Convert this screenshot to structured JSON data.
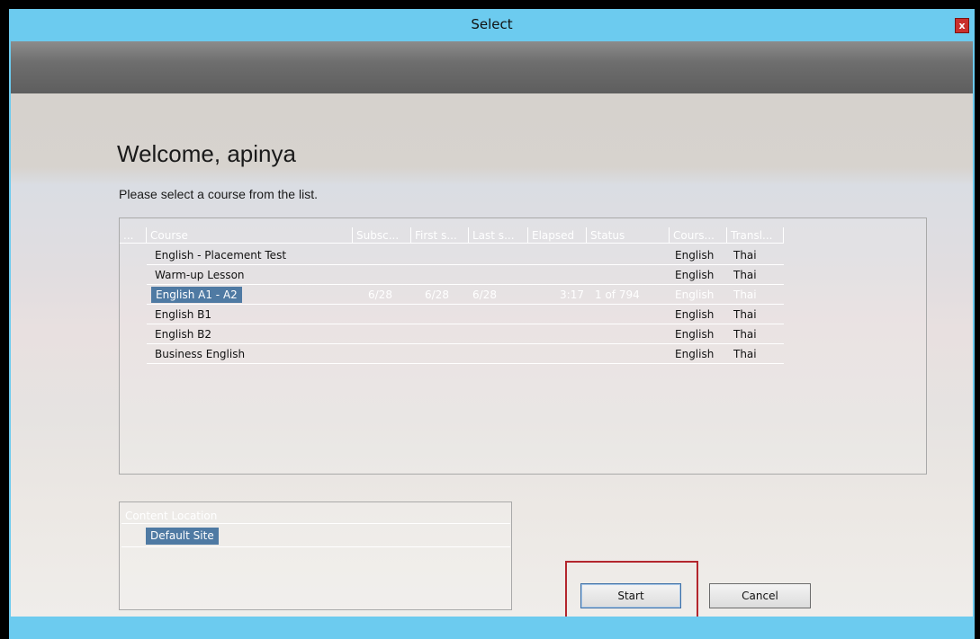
{
  "window": {
    "title": "Select",
    "close_label": "x"
  },
  "welcome_text": "Welcome, apinya",
  "instruction_text": "Please select a course from the list.",
  "course_table": {
    "columns": [
      "...",
      "Course",
      "Subsc...",
      "First s...",
      "Last s...",
      "Elapsed",
      "Status",
      "Cours...",
      "Transl..."
    ],
    "rows": [
      {
        "course": "English - Placement Test",
        "subsc": "",
        "first": "",
        "last": "",
        "elapsed": "",
        "status": "",
        "course_lang": "English",
        "transl": "Thai",
        "selected": false
      },
      {
        "course": "Warm-up Lesson",
        "subsc": "",
        "first": "",
        "last": "",
        "elapsed": "",
        "status": "",
        "course_lang": "English",
        "transl": "Thai",
        "selected": false
      },
      {
        "course": "English A1 - A2",
        "subsc": "6/28",
        "first": "6/28",
        "last": "6/28",
        "elapsed": "3:17",
        "status": "1 of 794",
        "course_lang": "English",
        "transl": "Thai",
        "selected": true
      },
      {
        "course": "English B1",
        "subsc": "",
        "first": "",
        "last": "",
        "elapsed": "",
        "status": "",
        "course_lang": "English",
        "transl": "Thai",
        "selected": false
      },
      {
        "course": "English B2",
        "subsc": "",
        "first": "",
        "last": "",
        "elapsed": "",
        "status": "",
        "course_lang": "English",
        "transl": "Thai",
        "selected": false
      },
      {
        "course": "Business English",
        "subsc": "",
        "first": "",
        "last": "",
        "elapsed": "",
        "status": "",
        "course_lang": "English",
        "transl": "Thai",
        "selected": false
      }
    ]
  },
  "content_location": {
    "header": "Content Location",
    "items": [
      "Default Site"
    ]
  },
  "buttons": {
    "start": "Start",
    "cancel": "Cancel"
  },
  "colors": {
    "titlebar": "#6ccbef",
    "selection": "#4f7aa3",
    "highlight_box": "#b3262d"
  }
}
